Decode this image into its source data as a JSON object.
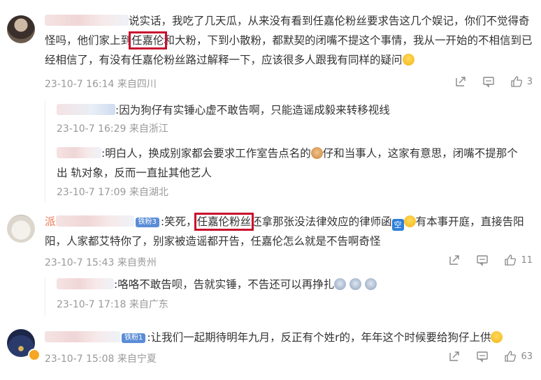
{
  "comments": [
    {
      "text_pre": "说实话，我吃了几天瓜，从来没有看到任嘉伦粉丝要求告这几个娱记，你们不觉得奇怪吗，他们家上到",
      "highlight": "任嘉伦",
      "text_post": "和大粉，下到小散粉，都默契的闭嘴不提这个事情，我从一开始的不相信到已经相信了，有没有任嘉伦粉丝路过解释一下，应该很多人跟我有同样的疑问",
      "meta": "23-10-7 16:14 来自四川",
      "likes": "3",
      "replies": [
        {
          "text": ":因为狗仔有实锤心虚不敢告啊，只能造谣成毅来转移视线",
          "meta": "23-10-7 16:29 来自浙江"
        },
        {
          "text_pre": ":明白人，换成别家都会要求工作室告点名的",
          "text_post": "仔和当事人，这家有意思，闭嘴不提那个出 轨对象，反而一直扯其他艺人",
          "meta": "23-10-7 17:09 来自湖北"
        }
      ]
    },
    {
      "name_prefix": "派",
      "badge": "铁粉3",
      "text_pre": ":笑死，",
      "highlight": "任嘉伦粉丝",
      "text_post": "还拿那张没法律效应的律师函",
      "text_square": "空",
      "text_post2": "有本事开庭，直接告阳阳，人家都艾特你了，别家被造谣都开告，任嘉伦怎么就是不告啊奇怪",
      "meta": "23-10-7 15:43 来自贵州",
      "likes": "11",
      "replies": [
        {
          "text": ":咯咯不敢告呗，告就实锤，不告还可以再挣扎",
          "meta": "23-10-7 17:18 来自广东"
        }
      ]
    },
    {
      "badge": "铁粉1",
      "text": ":让我们一起期待明年九月，反正有个姓r的，年年这个时候要给狗仔上供",
      "meta": "23-10-7 15:08 来自宁夏",
      "likes": "63"
    }
  ],
  "icons": {
    "share": "share-icon",
    "comment": "comment-icon",
    "like": "like-icon"
  }
}
